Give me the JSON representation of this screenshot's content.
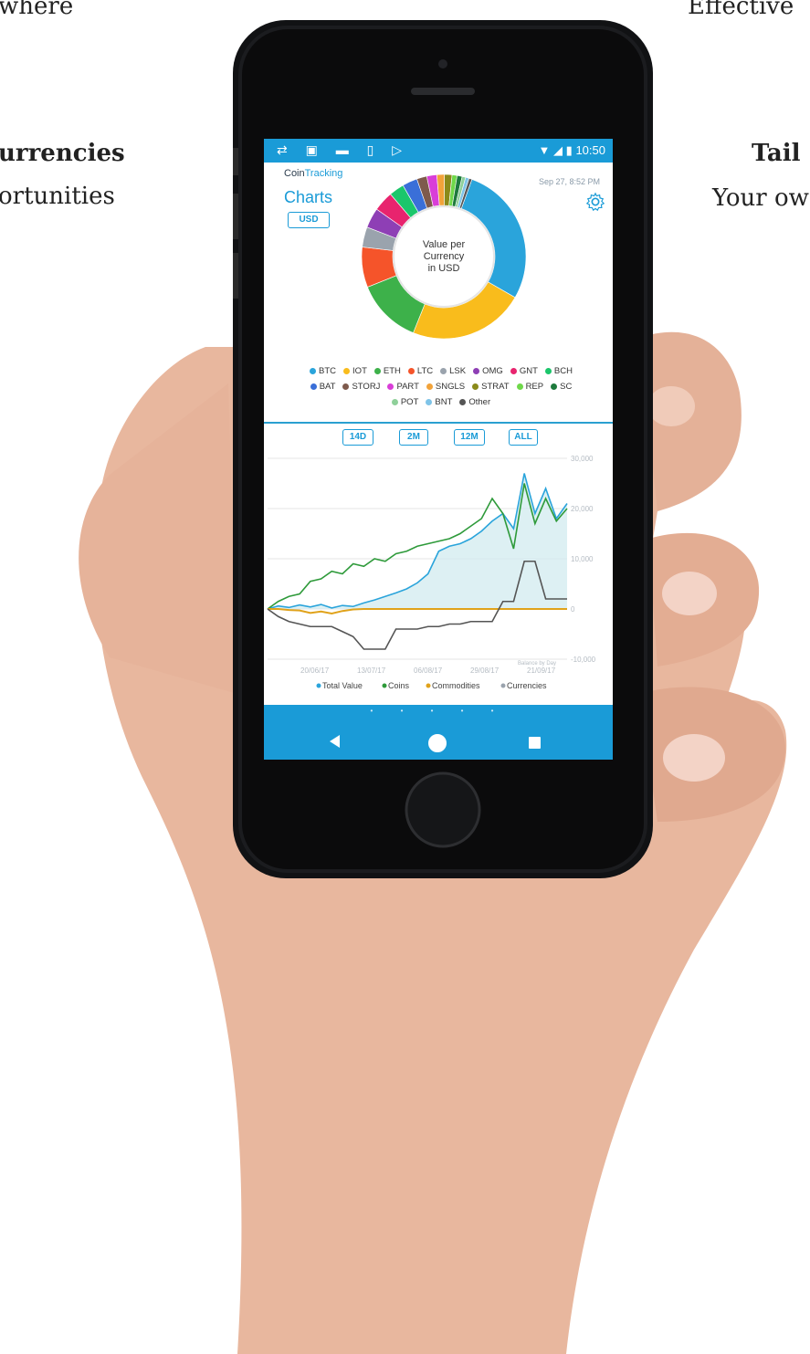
{
  "background": {
    "left_line1": "where",
    "left_heading": "urrencies",
    "left_line2": "ortunities",
    "right_line1": "Effective",
    "right_heading": "Tail",
    "right_line2": "Your ow"
  },
  "statusbar": {
    "icons": [
      "sync-icon",
      "photo-icon",
      "image-icon",
      "sim-icon",
      "play-icon"
    ],
    "time": "10:50"
  },
  "header": {
    "brand_prefix": "Coin",
    "brand_suffix": "Tracking",
    "title": "Charts",
    "currency_button": "USD",
    "timestamp": "Sep 27, 8:52 PM"
  },
  "donut": {
    "center_line1": "Value per",
    "center_line2": "Currency",
    "center_line3": "in USD",
    "slices": [
      {
        "name": "BTC",
        "value": 28,
        "color": "#2aa4db"
      },
      {
        "name": "IOT",
        "value": 23,
        "color": "#f9bc1c"
      },
      {
        "name": "ETH",
        "value": 13,
        "color": "#3db14a"
      },
      {
        "name": "LTC",
        "value": 8,
        "color": "#f5542a"
      },
      {
        "name": "LSK",
        "value": 4,
        "color": "#9aa3ad"
      },
      {
        "name": "OMG",
        "value": 4,
        "color": "#8e3fb5"
      },
      {
        "name": "GNT",
        "value": 4,
        "color": "#e8246e"
      },
      {
        "name": "BCH",
        "value": 3,
        "color": "#1bc66b"
      },
      {
        "name": "BAT",
        "value": 3,
        "color": "#3a6fd8"
      },
      {
        "name": "STORJ",
        "value": 2,
        "color": "#7e5a4c"
      },
      {
        "name": "PART",
        "value": 2,
        "color": "#d93ed8"
      },
      {
        "name": "SNGLS",
        "value": 1.5,
        "color": "#f2a33a"
      },
      {
        "name": "STRAT",
        "value": 1.5,
        "color": "#8a8a1a"
      },
      {
        "name": "REP",
        "value": 1,
        "color": "#6fd84a"
      },
      {
        "name": "SC",
        "value": 1,
        "color": "#1e7a3c"
      },
      {
        "name": "POT",
        "value": 0.7,
        "color": "#8fd09a"
      },
      {
        "name": "BNT",
        "value": 0.7,
        "color": "#7fc4e8"
      },
      {
        "name": "Other",
        "value": 0.6,
        "color": "#555555"
      }
    ]
  },
  "legend": {
    "row1": [
      {
        "label": "BTC",
        "color": "#2aa4db"
      },
      {
        "label": "IOT",
        "color": "#f9bc1c"
      },
      {
        "label": "ETH",
        "color": "#3db14a"
      },
      {
        "label": "LTC",
        "color": "#f5542a"
      },
      {
        "label": "LSK",
        "color": "#9aa3ad"
      },
      {
        "label": "OMG",
        "color": "#8e3fb5"
      },
      {
        "label": "GNT",
        "color": "#e8246e"
      },
      {
        "label": "BCH",
        "color": "#1bc66b"
      }
    ],
    "row2": [
      {
        "label": "BAT",
        "color": "#3a6fd8"
      },
      {
        "label": "STORJ",
        "color": "#7e5a4c"
      },
      {
        "label": "PART",
        "color": "#d93ed8"
      },
      {
        "label": "SNGLS",
        "color": "#f2a33a"
      },
      {
        "label": "STRAT",
        "color": "#8a8a1a"
      },
      {
        "label": "REP",
        "color": "#6fd84a"
      },
      {
        "label": "SC",
        "color": "#1e7a3c"
      }
    ],
    "row3": [
      {
        "label": "POT",
        "color": "#8fd09a"
      },
      {
        "label": "BNT",
        "color": "#7fc4e8"
      },
      {
        "label": "Other",
        "color": "#555555"
      }
    ]
  },
  "ranges": [
    "14D",
    "2M",
    "12M",
    "ALL"
  ],
  "chart_data": {
    "type": "line",
    "x_ticks": [
      "20/06/17",
      "13/07/17",
      "06/08/17",
      "29/08/17",
      "21/09/17"
    ],
    "y_ticks": [
      "30,000",
      "20,000",
      "10,000",
      "0",
      "-10,000"
    ],
    "ylim": [
      -10000,
      30000
    ],
    "annotation": "Balance by Day",
    "series": [
      {
        "name": "Total Value",
        "color": "#2aa4db",
        "values": [
          0,
          600,
          300,
          800,
          400,
          900,
          200,
          700,
          500,
          1200,
          1800,
          2500,
          3200,
          4000,
          5200,
          7000,
          11500,
          12500,
          13000,
          14000,
          15500,
          17500,
          19000,
          16000,
          27000,
          19000,
          24000,
          18000,
          21000
        ]
      },
      {
        "name": "Coins",
        "color": "#2e9a3a",
        "values": [
          0,
          1500,
          2500,
          3000,
          5500,
          6000,
          7500,
          7000,
          9000,
          8500,
          10000,
          9500,
          11000,
          11500,
          12500,
          13000,
          13500,
          14000,
          15000,
          16500,
          18000,
          22000,
          19000,
          12000,
          25000,
          17000,
          22000,
          17500,
          20000
        ]
      },
      {
        "name": "Commodities",
        "color": "#e0a21a",
        "values": [
          0,
          0,
          -200,
          -300,
          -800,
          -500,
          -900,
          -400,
          -100,
          0,
          0,
          0,
          0,
          0,
          0,
          0,
          0,
          0,
          0,
          0,
          0,
          0,
          0,
          0,
          0,
          0,
          0,
          0,
          0
        ]
      },
      {
        "name": "Currencies",
        "color": "#555555",
        "values": [
          0,
          -1500,
          -2500,
          -3000,
          -3500,
          -3500,
          -3500,
          -4500,
          -5500,
          -8000,
          -8000,
          -8000,
          -4000,
          -4000,
          -4000,
          -3500,
          -3500,
          -3000,
          -3000,
          -2500,
          -2500,
          -2500,
          1500,
          1500,
          9500,
          9500,
          2000,
          2000,
          2000
        ]
      }
    ]
  },
  "chart_legend": {
    "total": "Total Value",
    "coins": "Coins",
    "commodities": "Commodities",
    "currencies": "Currencies"
  },
  "navbar": {
    "page_dots": "• • • • •"
  }
}
